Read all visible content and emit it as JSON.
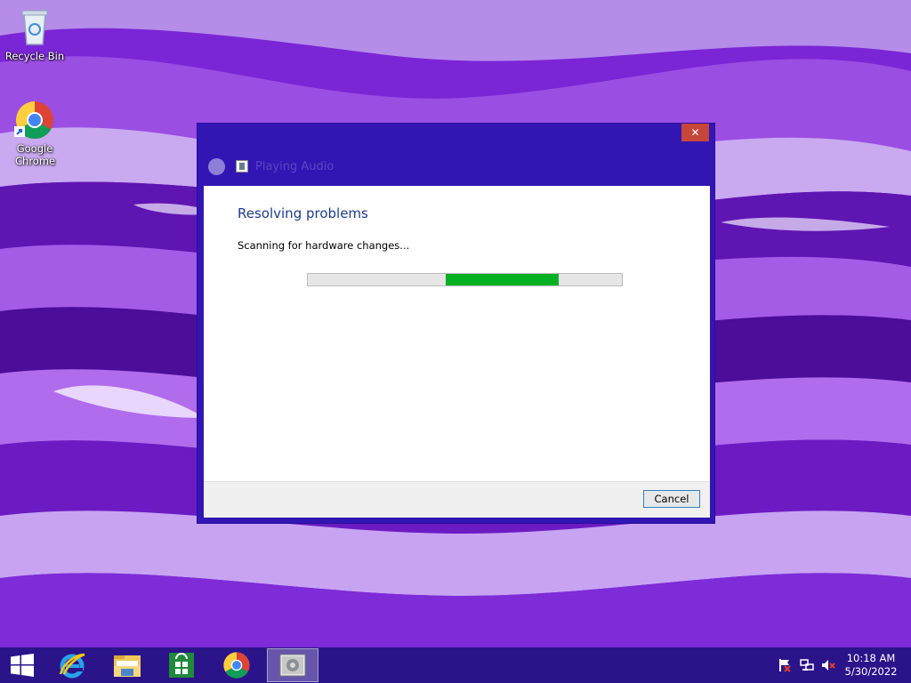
{
  "desktop": {
    "icons": [
      {
        "label": "Recycle Bin",
        "icon": "recycle-bin-icon"
      },
      {
        "label": "Google Chrome",
        "icon": "chrome-icon"
      }
    ]
  },
  "window": {
    "title": "Playing Audio",
    "close_label": "✕",
    "heading": "Resolving problems",
    "status": "Scanning for hardware changes...",
    "progress": {
      "mode": "indeterminate",
      "fill_start_fraction": 0.44,
      "fill_fraction": 0.36,
      "color": "#06b025"
    },
    "cancel_label": "Cancel"
  },
  "taskbar": {
    "pinned": [
      {
        "name": "start-button",
        "icon": "windows-logo-icon"
      },
      {
        "name": "internet-explorer",
        "icon": "internet-explorer-icon"
      },
      {
        "name": "file-explorer",
        "icon": "file-explorer-icon"
      },
      {
        "name": "store",
        "icon": "store-icon"
      },
      {
        "name": "chrome",
        "icon": "chrome-icon"
      },
      {
        "name": "troubleshooter",
        "icon": "troubleshooter-icon",
        "active": true
      }
    ],
    "tray": [
      "action-center-flag-icon",
      "network-icon",
      "volume-muted-icon"
    ],
    "time": "10:18 AM",
    "date": "5/30/2022"
  },
  "colors": {
    "accent": "#3216b4",
    "taskbar": "#2b148a",
    "heading": "#1e3c8c",
    "close": "#c7463a"
  }
}
